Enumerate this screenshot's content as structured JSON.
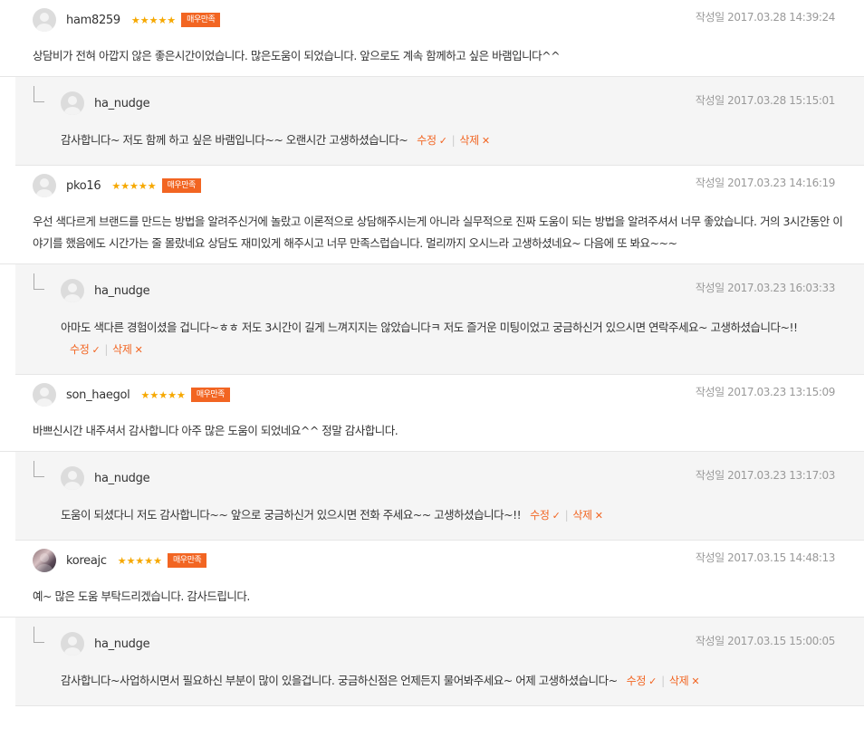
{
  "labels": {
    "edit": "수정",
    "delete": "삭제",
    "date_prefix": "작성일"
  },
  "reviews": [
    {
      "user": "ham8259",
      "stars": "★★★★★",
      "badge": "매우만족",
      "date": "작성일 2017.03.28 14:39:24",
      "text": "상담비가 전혀 아깝지 않은 좋은시간이었습니다. 많은도움이 되었습니다. 앞으로도 계속 함께하고 싶은 바램입니다^^",
      "reply": {
        "user": "ha_nudge",
        "date": "작성일 2017.03.28 15:15:01",
        "text": "감사합니다~ 저도 함께 하고 싶은 바램입니다~~ 오랜시간 고생하셨습니다~"
      }
    },
    {
      "user": "pko16",
      "stars": "★★★★★",
      "badge": "매우만족",
      "date": "작성일 2017.03.23 14:16:19",
      "text": "우선 색다르게 브랜드를 만드는 방법을 알려주신거에 놀랐고 이론적으로 상담해주시는게 아니라 실무적으로 진짜 도움이 되는 방법을 알려주셔서 너무 좋았습니다. 거의 3시간동안 이야기를 했음에도 시간가는 줄 몰랐네요 상담도 재미있게 해주시고 너무 만족스럽습니다. 멀리까지 오시느라 고생하셨네요~ 다음에 또 봐요~~~",
      "reply": {
        "user": "ha_nudge",
        "date": "작성일 2017.03.23 16:03:33",
        "text": "아마도 색다른 경험이셨을 겁니다~ㅎㅎ 저도 3시간이 길게 느껴지지는 않았습니다ㅋ 저도 즐거운 미팅이었고 궁금하신거 있으시면 연락주세요~ 고생하셨습니다~!!"
      }
    },
    {
      "user": "son_haegol",
      "stars": "★★★★★",
      "badge": "매우만족",
      "date": "작성일 2017.03.23 13:15:09",
      "text": "바쁘신시간 내주셔서 감사합니다 아주 많은 도움이 되었네요^^ 정말 감사합니다.",
      "reply": {
        "user": "ha_nudge",
        "date": "작성일 2017.03.23 13:17:03",
        "text": "도움이 되셨다니 저도 감사합니다~~ 앞으로 궁금하신거 있으시면 전화 주세요~~ 고생하셨습니다~!!"
      }
    },
    {
      "user": "koreajc",
      "stars": "★★★★★",
      "badge": "매우만족",
      "date": "작성일 2017.03.15 14:48:13",
      "text": "예~ 많은 도움 부탁드리겠습니다. 감사드립니다.",
      "reply": {
        "user": "ha_nudge",
        "date": "작성일 2017.03.15 15:00:05",
        "text": "감사합니다~사업하시면서 필요하신 부분이 많이 있을겁니다. 궁금하신점은 언제든지 물어봐주세요~ 어제 고생하셨습니다~"
      }
    }
  ],
  "colors": {
    "accent": "#f26522",
    "star": "#f6a800",
    "reply_bg": "#f5f5f5"
  },
  "icons": {
    "edit": "check-icon",
    "delete": "close-icon"
  }
}
